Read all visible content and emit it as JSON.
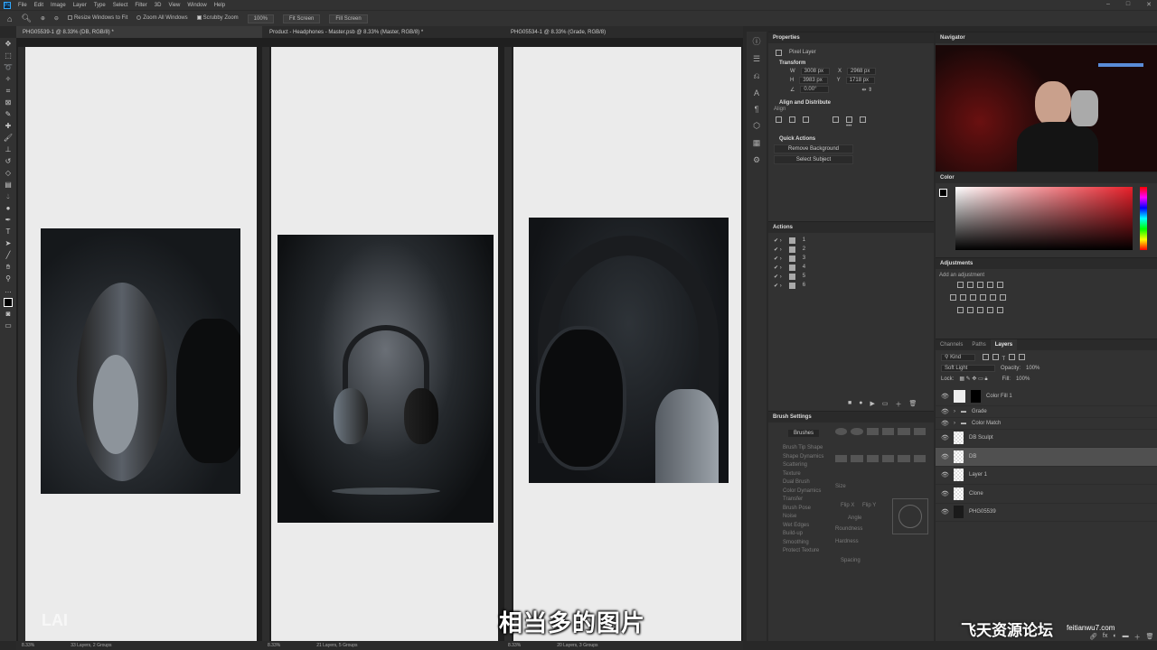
{
  "menu": [
    "File",
    "Edit",
    "Image",
    "Layer",
    "Type",
    "Select",
    "Filter",
    "3D",
    "View",
    "Window",
    "Help"
  ],
  "options": {
    "resize": "Resize Windows to Fit",
    "zoom_all": "Zoom All Windows",
    "scrubby": "Scrubby Zoom",
    "zoom": "100%",
    "fit": "Fit Screen",
    "fill": "Fill Screen"
  },
  "docs": [
    {
      "tab": "PHG05539-1 @ 8.33% (DB, RGB/8) *",
      "zoom": "8.33%",
      "info": "33 Layers, 2 Groups"
    },
    {
      "tab": "Product - Headphones - Master.psb @ 8.33% (Master, RGB/8) *",
      "zoom": "8.33%",
      "info": "21 Layers, 5 Groups"
    },
    {
      "tab": "PHG05534-1 @ 8.33% (Grade, RGB/8)",
      "zoom": "8.33%",
      "info": "20 Layers, 3 Groups"
    }
  ],
  "properties": {
    "title": "Properties",
    "layer_type": "Pixel Layer",
    "transform": "Transform",
    "w": "3008 px",
    "x": "2968 px",
    "h": "3983 px",
    "y": "1718 px",
    "angle": "0.00°",
    "align": "Align and Distribute",
    "align_label": "Align",
    "quick": "Quick Actions",
    "remove_bg": "Remove Background",
    "select_subject": "Select Subject"
  },
  "actions": {
    "title": "Actions",
    "items": [
      "1",
      "2",
      "3",
      "4",
      "5",
      "6"
    ]
  },
  "brush": {
    "title": "Brush Settings",
    "brushes_btn": "Brushes",
    "items": [
      "Brush Tip Shape",
      "Shape Dynamics",
      "Scattering",
      "Texture",
      "Dual Brush",
      "Color Dynamics",
      "Transfer",
      "Brush Pose",
      "Noise",
      "Wet Edges",
      "Build-up",
      "Smoothing",
      "Protect Texture"
    ],
    "size": "Size",
    "flip_x": "Flip X",
    "flip_y": "Flip Y",
    "angle": "Angle",
    "roundness": "Roundness",
    "hardness": "Hardness",
    "spacing": "Spacing"
  },
  "navigator": {
    "title": "Navigator"
  },
  "color": {
    "title": "Color",
    "accent": "#e8202a"
  },
  "adjustments": {
    "title": "Adjustments",
    "add": "Add an adjustment"
  },
  "layers": {
    "tabs": [
      "Channels",
      "Paths",
      "Layers"
    ],
    "kind": "Kind",
    "blend": "Soft Light",
    "opacity_label": "Opacity:",
    "opacity": "100%",
    "lock": "Lock:",
    "fill_label": "Fill:",
    "fill": "100%",
    "items": [
      "Color Fill 1",
      "Grade",
      "Color Match",
      "DB Sculpt",
      "DB",
      "Layer 1",
      "Clone",
      "PHG05539"
    ]
  },
  "subtitle": "相当多的图片",
  "watermark": "飞天资源论坛",
  "watermark_url": "feitianwu7.com",
  "logo_text": "LAI"
}
